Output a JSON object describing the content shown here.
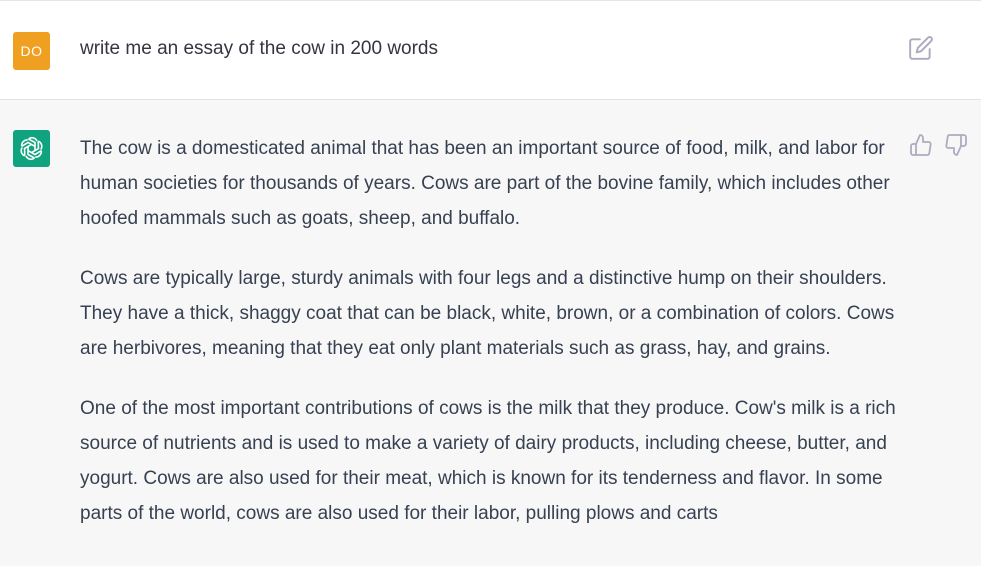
{
  "user_message": {
    "avatar_initials": "DO",
    "avatar_color": "#f0a020",
    "text": "write me an essay of the cow in 200 words",
    "edit_icon": "edit-icon"
  },
  "assistant_message": {
    "avatar_color": "#10a37f",
    "avatar_icon": "openai-logo-icon",
    "paragraphs": [
      "The cow is a domesticated animal that has been an important source of food, milk, and labor for human societies for thousands of years. Cows are part of the bovine family, which includes other hoofed mammals such as goats, sheep, and buffalo.",
      "Cows are typically large, sturdy animals with four legs and a distinctive hump on their shoulders. They have a thick, shaggy coat that can be black, white, brown, or a combination of colors. Cows are herbivores, meaning that they eat only plant materials such as grass, hay, and grains.",
      "One of the most important contributions of cows is the milk that they produce. Cow's milk is a rich source of nutrients and is used to make a variety of dairy products, including cheese, butter, and yogurt. Cows are also used for their meat, which is known for its tenderness and flavor. In some parts of the world, cows are also used for their labor, pulling plows and carts"
    ],
    "feedback_icons": [
      "thumbs-up-icon",
      "thumbs-down-icon"
    ]
  }
}
